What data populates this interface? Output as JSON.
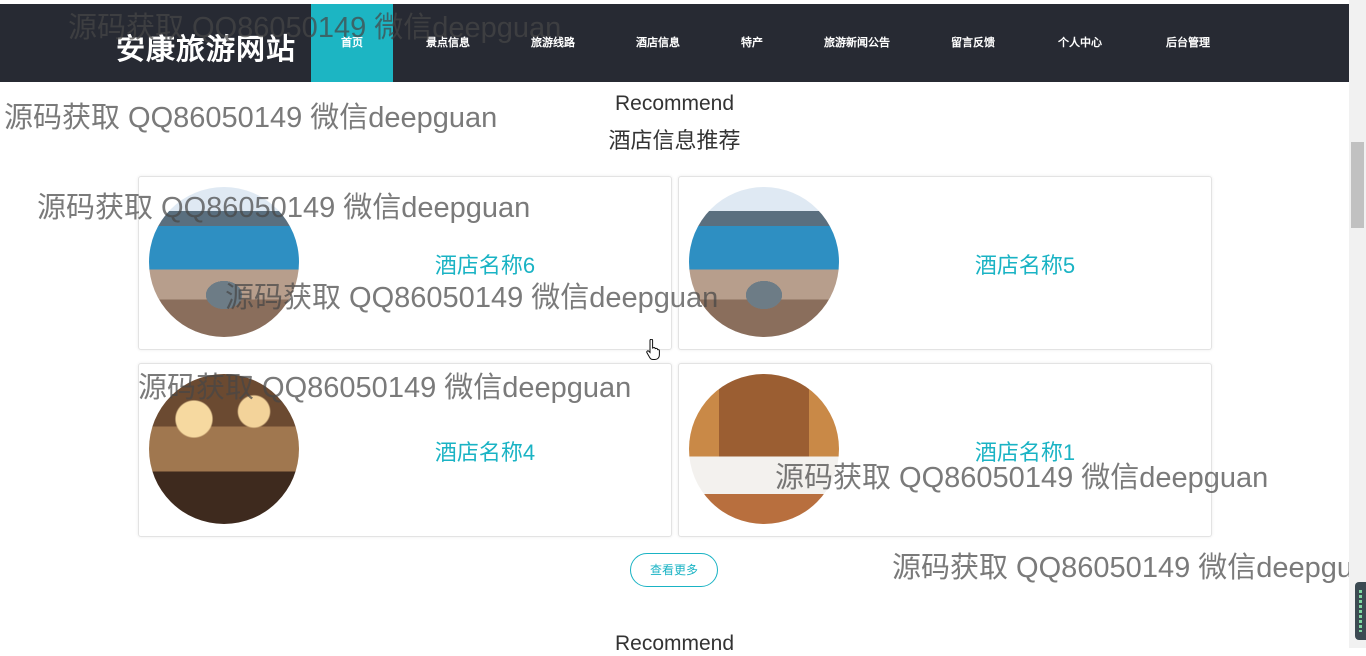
{
  "site": {
    "brand": "安康旅游网站"
  },
  "nav": [
    {
      "label": "首页",
      "active": true
    },
    {
      "label": "景点信息",
      "active": false
    },
    {
      "label": "旅游线路",
      "active": false
    },
    {
      "label": "酒店信息",
      "active": false
    },
    {
      "label": "特产",
      "active": false
    },
    {
      "label": "旅游新闻公告",
      "active": false
    },
    {
      "label": "留言反馈",
      "active": false
    },
    {
      "label": "个人中心",
      "active": false
    },
    {
      "label": "后台管理",
      "active": false
    }
  ],
  "hotel_section": {
    "eyebrow": "Recommend",
    "title": "酒店信息推荐",
    "cards": [
      {
        "name": "酒店名称6",
        "image": "lake-city-photo"
      },
      {
        "name": "酒店名称5",
        "image": "lake-city-photo"
      },
      {
        "name": "酒店名称4",
        "image": "ballroom-photo"
      },
      {
        "name": "酒店名称1",
        "image": "wooden-bedroom-photo"
      }
    ],
    "more_button": "查看更多"
  },
  "next_section": {
    "eyebrow": "Recommend"
  },
  "watermark": "源码获取 QQ86050149 微信deepguan",
  "colors": {
    "nav_bg": "#272a33",
    "accent": "#1cb5c3",
    "card_text": "#1ab3c4"
  }
}
